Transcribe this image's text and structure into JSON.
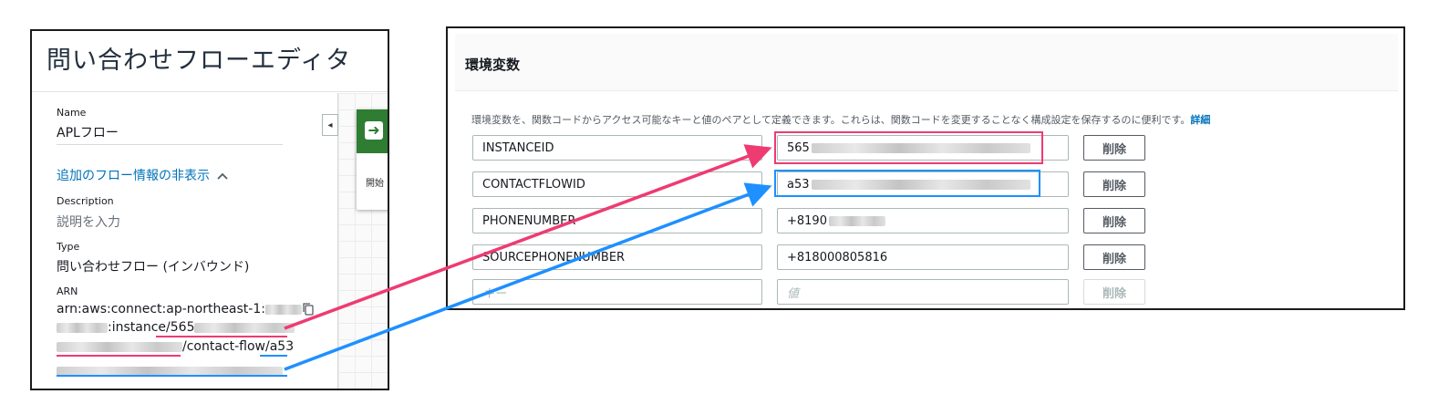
{
  "colors": {
    "pink": "#ee3b72",
    "blue": "#1e90ff",
    "link": "#0073bb",
    "flow_green": "#2f7d32"
  },
  "left": {
    "title": "問い合わせフローエディタ",
    "name_label": "Name",
    "name_value": "APLフロー",
    "toggle_label": "追加のフロー情報の非表示",
    "toggle_icon": "chevron-up-icon",
    "description_label": "Description",
    "description_placeholder": "説明を入力",
    "type_label": "Type",
    "type_value": "問い合わせフロー (インバウンド)",
    "arn_label": "ARN",
    "arn_line1": "arn:aws:connect:ap-northeast-1:",
    "arn_line2_mid": ":instance/",
    "arn_instance_prefix": "565",
    "arn_line3_mid": "/contact-flow/",
    "arn_flow_prefix": "a53",
    "copy_icon": "copy-icon",
    "collapse_icon": "◂",
    "flow_block_label": "開始"
  },
  "env": {
    "title": "環境変数",
    "description": "環境変数を、関数コードからアクセス可能なキーと値のペアとして定義できます。これらは、関数コードを変更することなく構成設定を保存するのに便利です。",
    "detail_link": "詳細",
    "rows": [
      {
        "key": "INSTANCEID",
        "value": "565",
        "delete": "削除"
      },
      {
        "key": "CONTACTFLOWID",
        "value": "a53",
        "delete": "削除"
      },
      {
        "key": "PHONENUMBER",
        "value": "+8190",
        "delete": "削除"
      },
      {
        "key": "SOURCEPHONENUMBER",
        "value": "+818000805816",
        "delete": "削除"
      }
    ],
    "new_row": {
      "key_placeholder": "キー",
      "value_placeholder": "値",
      "delete": "削除"
    }
  }
}
